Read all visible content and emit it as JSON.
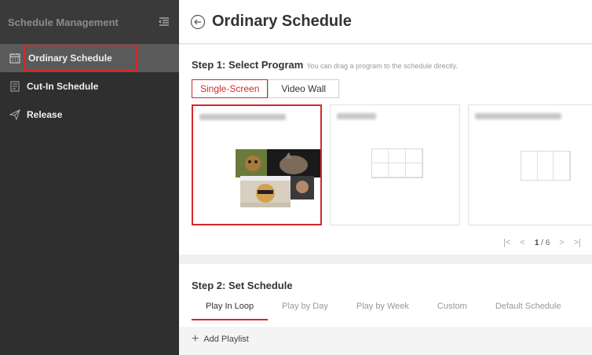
{
  "sidebar": {
    "title": "Schedule Management",
    "items": [
      {
        "label": "Ordinary Schedule",
        "icon": "calendar-icon",
        "active": true
      },
      {
        "label": "Cut-In Schedule",
        "icon": "document-icon",
        "active": false
      },
      {
        "label": "Release",
        "icon": "send-icon",
        "active": false
      }
    ]
  },
  "header": {
    "title": "Ordinary Schedule"
  },
  "step1": {
    "title": "Step 1: Select Program",
    "hint": "You can drag a program to the schedule directly.",
    "modes": [
      "Single-Screen",
      "Video Wall"
    ]
  },
  "pager": {
    "current": "1",
    "total": "6"
  },
  "step2": {
    "title": "Step 2: Set Schedule",
    "tabs": [
      "Play In Loop",
      "Play by Day",
      "Play by Week",
      "Custom",
      "Default Schedule"
    ],
    "add_playlist": "Add Playlist"
  },
  "colors": {
    "accent": "#d4282a",
    "sidebar_bg": "#2f2f2f"
  }
}
